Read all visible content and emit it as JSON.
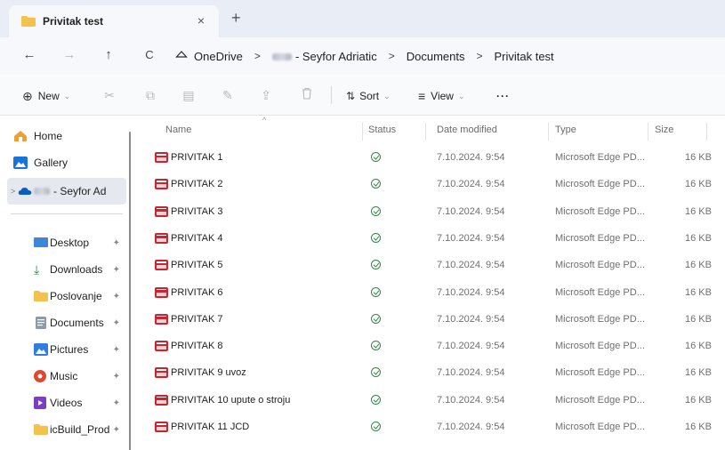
{
  "tab": {
    "title": "Privitak test",
    "close": "×",
    "new_tab": "+"
  },
  "nav": {
    "back": "←",
    "forward": "→",
    "up": "↑",
    "refresh": "C"
  },
  "breadcrumb": {
    "items": [
      "OneDrive",
      "- Seyfor Adriatic",
      "Documents",
      "Privitak test"
    ],
    "separator": ">"
  },
  "toolbar": {
    "new_label": "New",
    "new_icon": "⊕",
    "chevron": "⌄",
    "sort_label": "Sort",
    "sort_icon": "⇅",
    "view_label": "View",
    "view_icon": "≡",
    "more_label": "···",
    "cut_icon": "✂",
    "copy_icon": "⧉",
    "paste_icon": "▤",
    "rename_icon": "✎",
    "share_icon": "⇪",
    "delete_icon": "🗑"
  },
  "sidebar": {
    "items": [
      {
        "label": "Home",
        "icon": "home-icon"
      },
      {
        "label": "Gallery",
        "icon": "gallery-icon"
      },
      {
        "label": "- Seyfor Ad",
        "icon": "onedrive-icon"
      },
      {
        "label": "Desktop",
        "icon": "desktop-icon",
        "pinned": true
      },
      {
        "label": "Downloads",
        "icon": "download-icon",
        "pinned": true
      },
      {
        "label": "Poslovanje",
        "icon": "folder-icon",
        "pinned": true
      },
      {
        "label": "Documents",
        "icon": "documents-icon",
        "pinned": true
      },
      {
        "label": "Pictures",
        "icon": "pictures-icon",
        "pinned": true
      },
      {
        "label": "Music",
        "icon": "music-icon",
        "pinned": true
      },
      {
        "label": "Videos",
        "icon": "videos-icon",
        "pinned": true
      },
      {
        "label": "icBuild_Prod",
        "icon": "folder-icon",
        "pinned": true
      }
    ],
    "pin_glyph": "📌",
    "expander": ">"
  },
  "columns": {
    "name": "Name",
    "status": "Status",
    "date": "Date modified",
    "type": "Type",
    "size": "Size",
    "sort_indicator": "^"
  },
  "files": [
    {
      "name": "PRIVITAK 1",
      "date": "7.10.2024. 9:54",
      "type": "Microsoft Edge PD...",
      "size": "16 KB"
    },
    {
      "name": "PRIVITAK 2",
      "date": "7.10.2024. 9:54",
      "type": "Microsoft Edge PD...",
      "size": "16 KB"
    },
    {
      "name": "PRIVITAK 3",
      "date": "7.10.2024. 9:54",
      "type": "Microsoft Edge PD...",
      "size": "16 KB"
    },
    {
      "name": "PRIVITAK 4",
      "date": "7.10.2024. 9:54",
      "type": "Microsoft Edge PD...",
      "size": "16 KB"
    },
    {
      "name": "PRIVITAK 5",
      "date": "7.10.2024. 9:54",
      "type": "Microsoft Edge PD...",
      "size": "16 KB"
    },
    {
      "name": "PRIVITAK 6",
      "date": "7.10.2024. 9:54",
      "type": "Microsoft Edge PD...",
      "size": "16 KB"
    },
    {
      "name": "PRIVITAK 7",
      "date": "7.10.2024. 9:54",
      "type": "Microsoft Edge PD...",
      "size": "16 KB"
    },
    {
      "name": "PRIVITAK 8",
      "date": "7.10.2024. 9:54",
      "type": "Microsoft Edge PD...",
      "size": "16 KB"
    },
    {
      "name": "PRIVITAK 9 uvoz",
      "date": "7.10.2024. 9:54",
      "type": "Microsoft Edge PD...",
      "size": "16 KB"
    },
    {
      "name": "PRIVITAK 10 upute o stroju",
      "date": "7.10.2024. 9:54",
      "type": "Microsoft Edge PD...",
      "size": "16 KB"
    },
    {
      "name": "PRIVITAK 11 JCD",
      "date": "7.10.2024. 9:54",
      "type": "Microsoft Edge PD...",
      "size": "16 KB"
    }
  ],
  "colors": {
    "accent": "#0067c0",
    "folder_yellow": "#f2c14e",
    "pdf_red": "#c8262f",
    "status_green": "#2e8a43"
  }
}
